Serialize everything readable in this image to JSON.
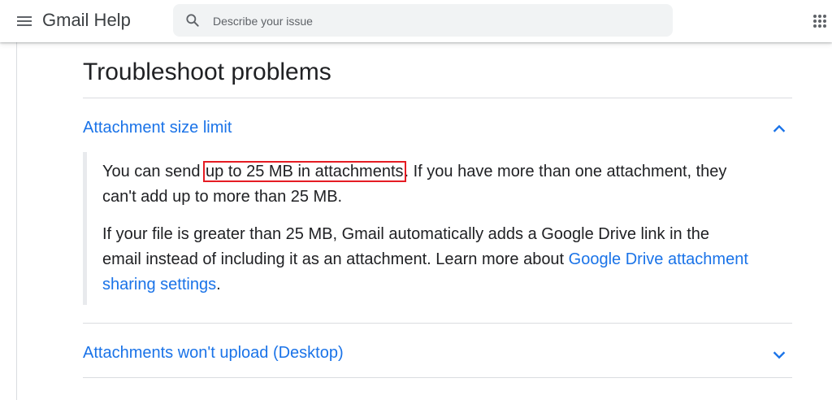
{
  "header": {
    "app_title": "Gmail Help",
    "search_placeholder": "Describe your issue"
  },
  "page_title": "Troubleshoot problems",
  "sections": [
    {
      "title": "Attachment size limit",
      "expanded": true,
      "para1": {
        "pre": "You can send ",
        "highlight": "up to 25 MB in attachments",
        "post": ". If you have more than one attachment, they can't add up to more than 25 MB."
      },
      "para2": {
        "text": "If your file is greater than 25 MB, Gmail automatically adds a Google Drive link in the email instead of including it as an attachment. Learn more about ",
        "link": "Google Drive attachment sharing settings",
        "post": "."
      }
    },
    {
      "title": "Attachments won't upload (Desktop)",
      "expanded": false
    }
  ],
  "colors": {
    "link": "#1a73e8",
    "highlight_box": "#e51c23"
  },
  "icons": [
    "menu-icon",
    "search-icon",
    "apps-grid-icon",
    "chevron-up-icon",
    "chevron-down-icon"
  ]
}
